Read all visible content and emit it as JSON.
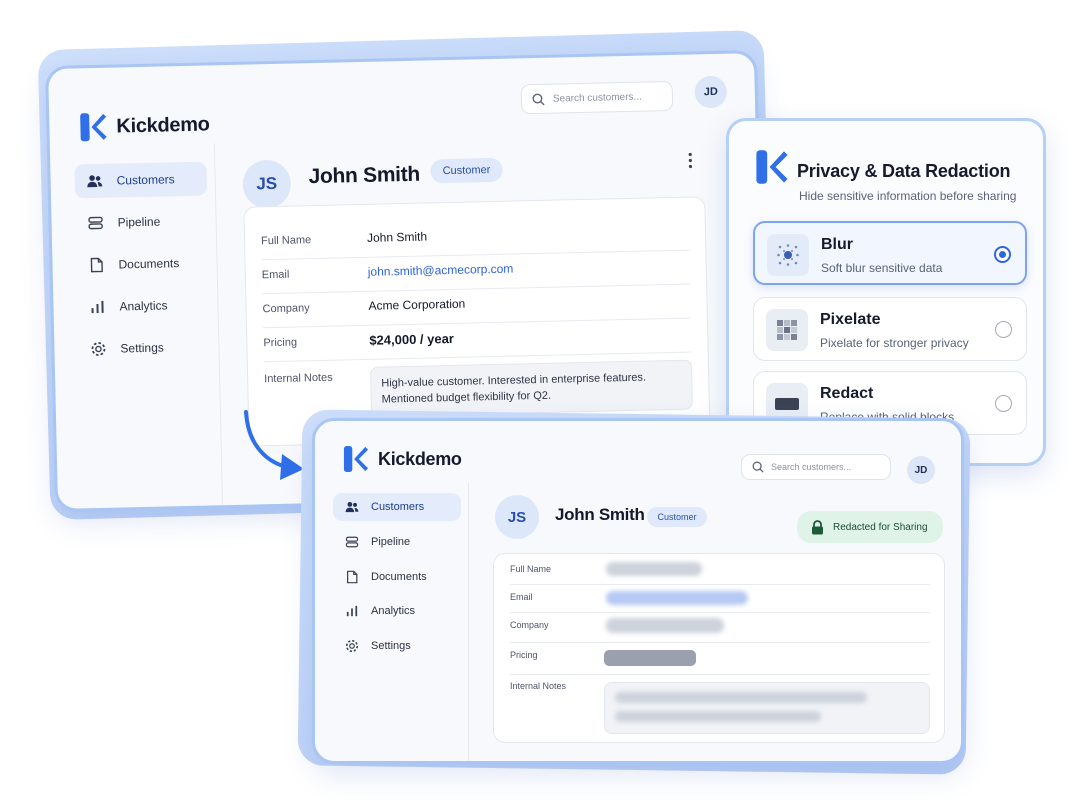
{
  "app": {
    "name": "Kickdemo"
  },
  "search": {
    "placeholder": "Search customers..."
  },
  "user": {
    "initials": "JD"
  },
  "nav": {
    "items": [
      {
        "label": "Customers",
        "icon": "users-icon",
        "active": true
      },
      {
        "label": "Pipeline",
        "icon": "pipeline-icon"
      },
      {
        "label": "Documents",
        "icon": "document-icon"
      },
      {
        "label": "Analytics",
        "icon": "bar-chart-icon"
      },
      {
        "label": "Settings",
        "icon": "gear-icon"
      }
    ]
  },
  "customer": {
    "initials": "JS",
    "name": "John Smith",
    "badge": "Customer",
    "fields": {
      "full_name": {
        "label": "Full Name",
        "value": "John Smith"
      },
      "email": {
        "label": "Email",
        "value": "john.smith@acmecorp.com"
      },
      "company": {
        "label": "Company",
        "value": "Acme Corporation"
      },
      "pricing": {
        "label": "Pricing",
        "value": "$24,000 / year"
      },
      "notes": {
        "label": "Internal Notes",
        "value": "High-value customer. Interested in enterprise features. Mentioned budget flexibility for Q2."
      }
    }
  },
  "privacy_panel": {
    "title": "Privacy & Data Redaction",
    "subtitle": "Hide sensitive information before sharing",
    "options": [
      {
        "title": "Blur",
        "desc": "Soft blur sensitive data",
        "icon": "blur-icon",
        "selected": true
      },
      {
        "title": "Pixelate",
        "desc": "Pixelate for stronger privacy",
        "icon": "pixelate-icon",
        "selected": false
      },
      {
        "title": "Redact",
        "desc": "Replace with solid blocks",
        "icon": "redact-icon",
        "selected": false
      }
    ]
  },
  "redacted_badge": {
    "label": "Redacted for Sharing",
    "icon": "lock-icon"
  },
  "colors": {
    "accent": "#2d66e0",
    "brand": "#2f6fe8",
    "redacted_bg": "#dff3e8"
  }
}
